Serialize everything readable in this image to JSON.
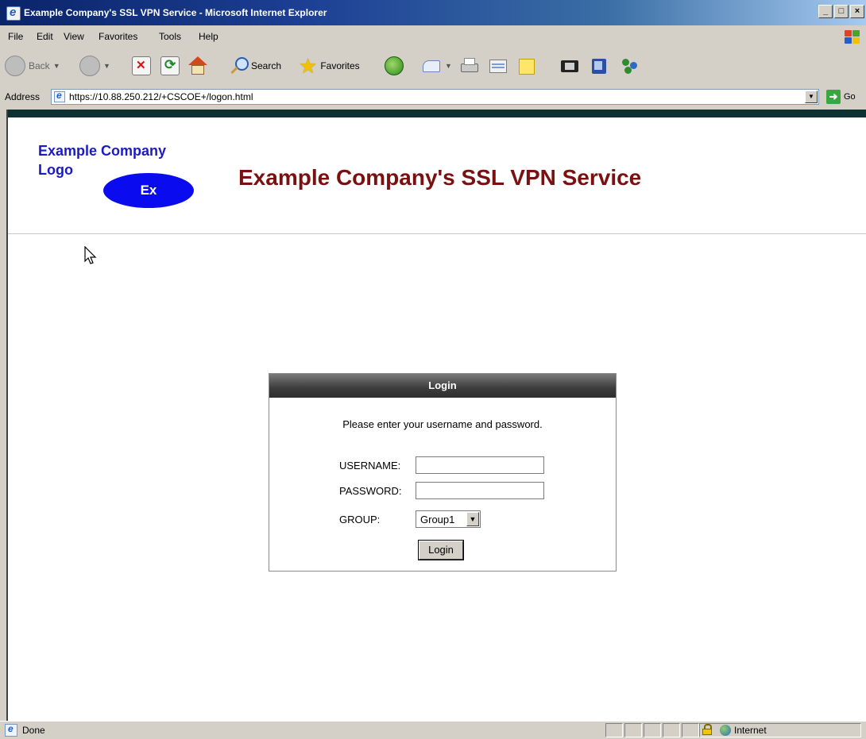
{
  "window": {
    "title": "Example Company's SSL VPN Service - Microsoft Internet Explorer",
    "controls": [
      "_",
      "□",
      "×"
    ]
  },
  "menu": [
    "File",
    "Edit",
    "View",
    "Favorites",
    "Tools",
    "Help"
  ],
  "toolbar": {
    "back_label": "Back",
    "search_label": "Search",
    "favorites_label": "Favorites"
  },
  "address": {
    "label": "Address",
    "url": "https://10.88.250.212/+CSCOE+/logon.html",
    "go_label": "Go"
  },
  "page": {
    "logo_text": "Example Company Logo",
    "logo_badge": "Ex",
    "title": "Example Company's SSL VPN Service",
    "login": {
      "header": "Login",
      "message": "Please enter your username and password.",
      "username_label": "USERNAME:",
      "password_label": "PASSWORD:",
      "group_label": "GROUP:",
      "group_value": "Group1",
      "button_label": "Login",
      "username_value": "",
      "password_value": ""
    }
  },
  "status": {
    "text": "Done",
    "zone": "Internet"
  },
  "colors": {
    "title_color": "#7a1010",
    "logo_color": "#1b1bc4",
    "badge_color": "#0b0bf0"
  }
}
